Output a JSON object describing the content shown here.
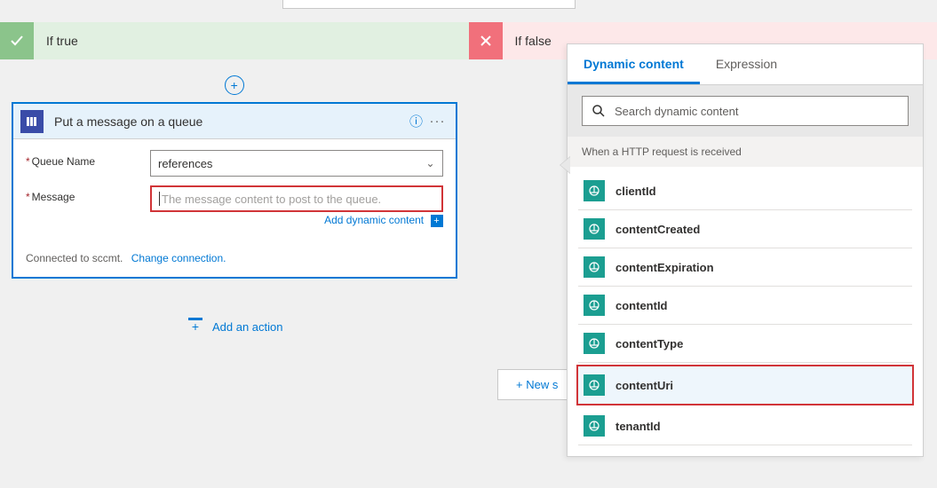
{
  "branches": {
    "ifTrue": {
      "label": "If true"
    },
    "ifFalse": {
      "label": "If false"
    }
  },
  "card": {
    "title": "Put a message on a queue",
    "fields": {
      "queueName": {
        "label": "Queue Name",
        "value": "references"
      },
      "message": {
        "label": "Message",
        "placeholder": "The message content to post to the queue."
      }
    },
    "addDynamicContentLabel": "Add dynamic content",
    "footer": {
      "connectedText": "Connected to sccmt.",
      "changeConnectionLabel": "Change connection."
    }
  },
  "addActionLabel": "Add an action",
  "newStepLabel": "+ New s",
  "dynPanel": {
    "tabs": {
      "dynamic": "Dynamic content",
      "expression": "Expression"
    },
    "searchPlaceholder": "Search dynamic content",
    "sectionHeader": "When a HTTP request is received",
    "items": [
      {
        "label": "clientId"
      },
      {
        "label": "contentCreated"
      },
      {
        "label": "contentExpiration"
      },
      {
        "label": "contentId"
      },
      {
        "label": "contentType"
      },
      {
        "label": "contentUri",
        "highlighted": true
      },
      {
        "label": "tenantId"
      }
    ]
  }
}
